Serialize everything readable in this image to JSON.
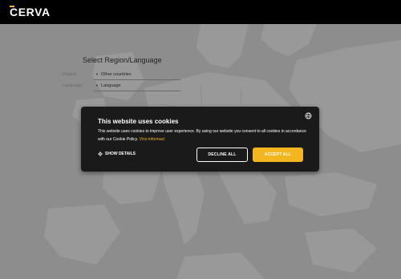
{
  "header": {
    "logo_text": "CERVA"
  },
  "region": {
    "title": "Select Region/Language",
    "region_label": "Region",
    "region_value": "Other countries",
    "language_label": "Language",
    "language_value": "Language"
  },
  "cookie": {
    "title": "This website uses cookies",
    "description": "This website uses cookies to improve user experience. By using our website you consent to all cookies in accordance with our Cookie Policy.",
    "link_text": "Více informací",
    "show_details": "SHOW DETAILS",
    "decline": "DECLINE ALL",
    "accept": "ACCEPT ALL"
  },
  "colors": {
    "accent": "#f3b61f",
    "header_bg": "#000000",
    "banner_bg": "#1a1a1a"
  },
  "icons": [
    "globe-icon",
    "gear-icon",
    "caret-icon"
  ]
}
